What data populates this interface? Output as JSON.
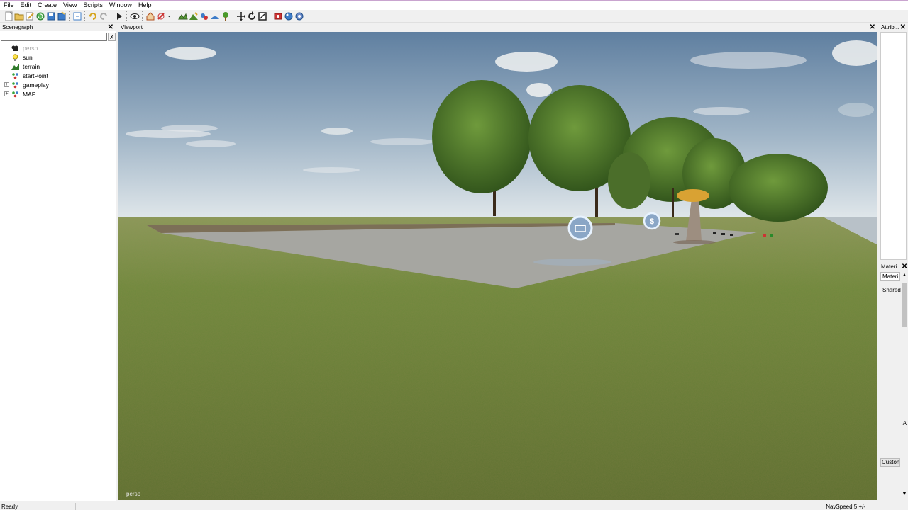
{
  "menu": [
    "File",
    "Edit",
    "Create",
    "View",
    "Scripts",
    "Window",
    "Help"
  ],
  "toolbar_icons": [
    "new-file-icon",
    "open-folder-icon",
    "edit-icon",
    "refresh-icon",
    "save-icon",
    "export-icon",
    "history-icon",
    "undo-icon",
    "redo-icon",
    "play-icon",
    "eye-icon",
    "house-icon",
    "no-tool-icon",
    "dropdown-arrow-icon",
    "terrain-paint-icon",
    "terrain-raise-icon",
    "foliage-icon",
    "terrain-smooth-icon",
    "tree-icon",
    "move-icon",
    "rotate-icon",
    "scale-icon",
    "render-icon",
    "material-icon",
    "settings-icon"
  ],
  "scenegraph": {
    "title": "Scenegraph",
    "close": "✕",
    "clear_button": "X",
    "search_value": "",
    "items": [
      {
        "label": "persp",
        "icon": "camera-icon",
        "expandable": false,
        "dim": true
      },
      {
        "label": "sun",
        "icon": "light-bulb-icon",
        "expandable": false,
        "dim": false
      },
      {
        "label": "terrain",
        "icon": "terrain-icon",
        "expandable": false,
        "dim": false
      },
      {
        "label": "startPoint",
        "icon": "transform-group-icon",
        "expandable": false,
        "dim": false
      },
      {
        "label": "gameplay",
        "icon": "transform-group-icon",
        "expandable": true,
        "dim": false
      },
      {
        "label": "MAP",
        "icon": "transform-group-icon",
        "expandable": true,
        "dim": false
      }
    ]
  },
  "viewport": {
    "title": "Viewport",
    "close": "✕",
    "camera_label": "persp"
  },
  "attributes": {
    "title": "Attrib...",
    "close": "✕"
  },
  "materials": {
    "title": "Materi...",
    "close": "✕",
    "tab": "Materi...",
    "shared_label": "Shared",
    "custom_button": "Custom",
    "mark": "A"
  },
  "status": {
    "left": "Ready",
    "right": "NavSpeed 5 +/-"
  },
  "colors": {
    "sky_top": "#6f8fae",
    "sky_horizon": "#d9e2ea",
    "grass": "#6e8a3c",
    "concrete": "#a3a39e",
    "tree": "#4d7a2a",
    "icon_ring": "#cfe8ff"
  }
}
